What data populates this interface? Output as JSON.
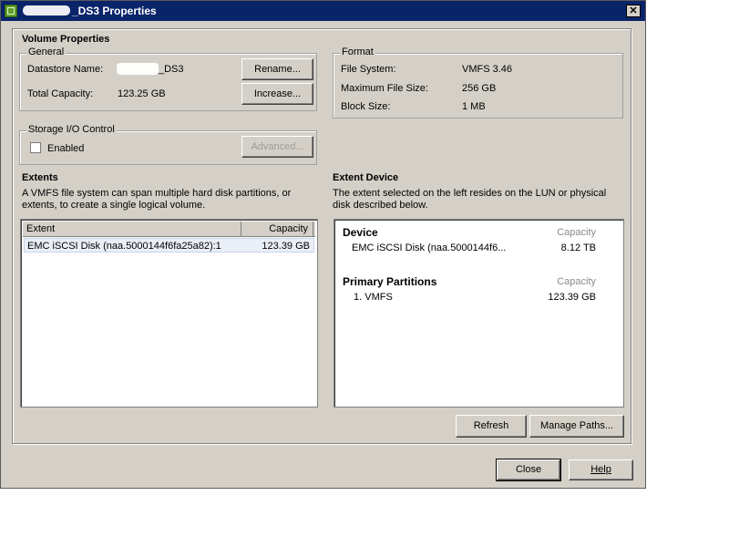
{
  "window": {
    "title": "_DS3 Properties",
    "close_symbol": "✕"
  },
  "volume_properties": {
    "heading": "Volume Properties",
    "general": {
      "legend": "General",
      "datastore_name_label": "Datastore Name:",
      "datastore_name_value": "_DS3",
      "total_capacity_label": "Total Capacity:",
      "total_capacity_value": "123.25 GB",
      "rename_button": "Rename...",
      "increase_button": "Increase..."
    },
    "storage_io": {
      "legend": "Storage I/O Control",
      "enabled_label": "Enabled",
      "enabled_checked": false,
      "advanced_button": "Advanced..."
    },
    "format": {
      "legend": "Format",
      "file_system_label": "File System:",
      "file_system_value": "VMFS 3.46",
      "max_file_size_label": "Maximum File Size:",
      "max_file_size_value": "256 GB",
      "block_size_label": "Block Size:",
      "block_size_value": "1 MB"
    }
  },
  "extents": {
    "heading": "Extents",
    "description_line1": "A VMFS file system can span multiple hard disk partitions, or",
    "description_line2": "extents, to create a single logical volume.",
    "columns": [
      "Extent",
      "Capacity"
    ],
    "rows": [
      {
        "extent": "EMC iSCSI Disk (naa.5000144f6fa25a82):1",
        "capacity": "123.39 GB"
      }
    ]
  },
  "extent_device": {
    "heading": "Extent Device",
    "description_line1": "The extent selected on the left resides on the LUN or physical",
    "description_line2": "disk described below.",
    "device_heading": "Device",
    "capacity_heading": "Capacity",
    "device_name": "EMC iSCSI Disk (naa.5000144f6...",
    "device_capacity": "8.12 TB",
    "partitions_heading": "Primary Partitions",
    "partitions_capacity_heading": "Capacity",
    "partition_name": "1. VMFS",
    "partition_capacity": "123.39 GB"
  },
  "buttons": {
    "refresh": "Refresh",
    "manage_paths": "Manage Paths...",
    "close": "Close",
    "help": "Help"
  }
}
